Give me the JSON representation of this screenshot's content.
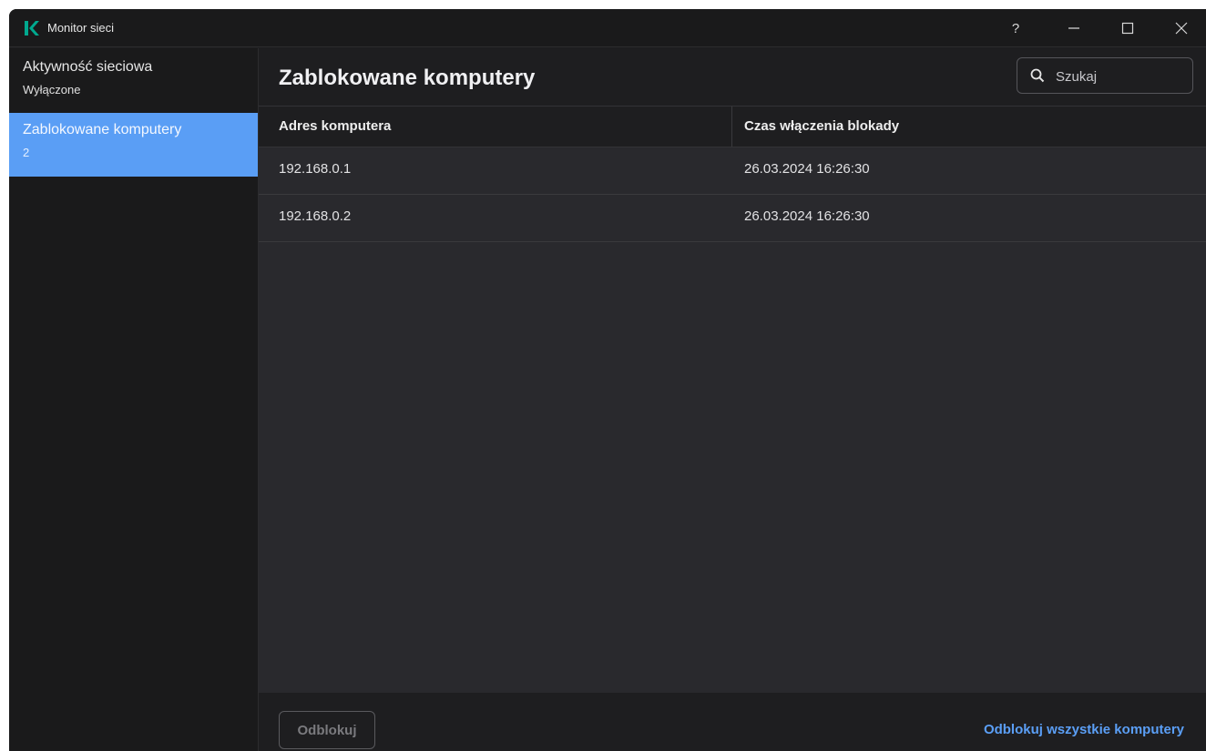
{
  "window": {
    "title": "Monitor sieci",
    "help_label": "?"
  },
  "sidebar": {
    "items": [
      {
        "label": "Aktywność sieciowa",
        "sub": "Wyłączone",
        "active": false
      },
      {
        "label": "Zablokowane komputery",
        "sub": "2",
        "active": true
      }
    ]
  },
  "main": {
    "title": "Zablokowane komputery",
    "search": {
      "placeholder": "Szukaj",
      "value": ""
    },
    "table": {
      "columns": [
        "Adres komputera",
        "Czas włączenia blokady"
      ],
      "rows": [
        [
          "192.168.0.1",
          "26.03.2024 16:26:30"
        ],
        [
          "192.168.0.2",
          "26.03.2024 16:26:30"
        ]
      ]
    },
    "footer": {
      "unblock_label": "Odblokuj",
      "unblock_all_label": "Odblokuj wszystkie komputery"
    }
  },
  "colors": {
    "accent": "#5a9ef5",
    "link": "#5b9ff6",
    "logo": "#00a88e",
    "background": "#1e1e20"
  },
  "icons": {
    "logo": "kaspersky-k-icon",
    "search": "search-icon",
    "minimize": "minimize-icon",
    "maximize": "maximize-icon",
    "close": "close-icon"
  }
}
